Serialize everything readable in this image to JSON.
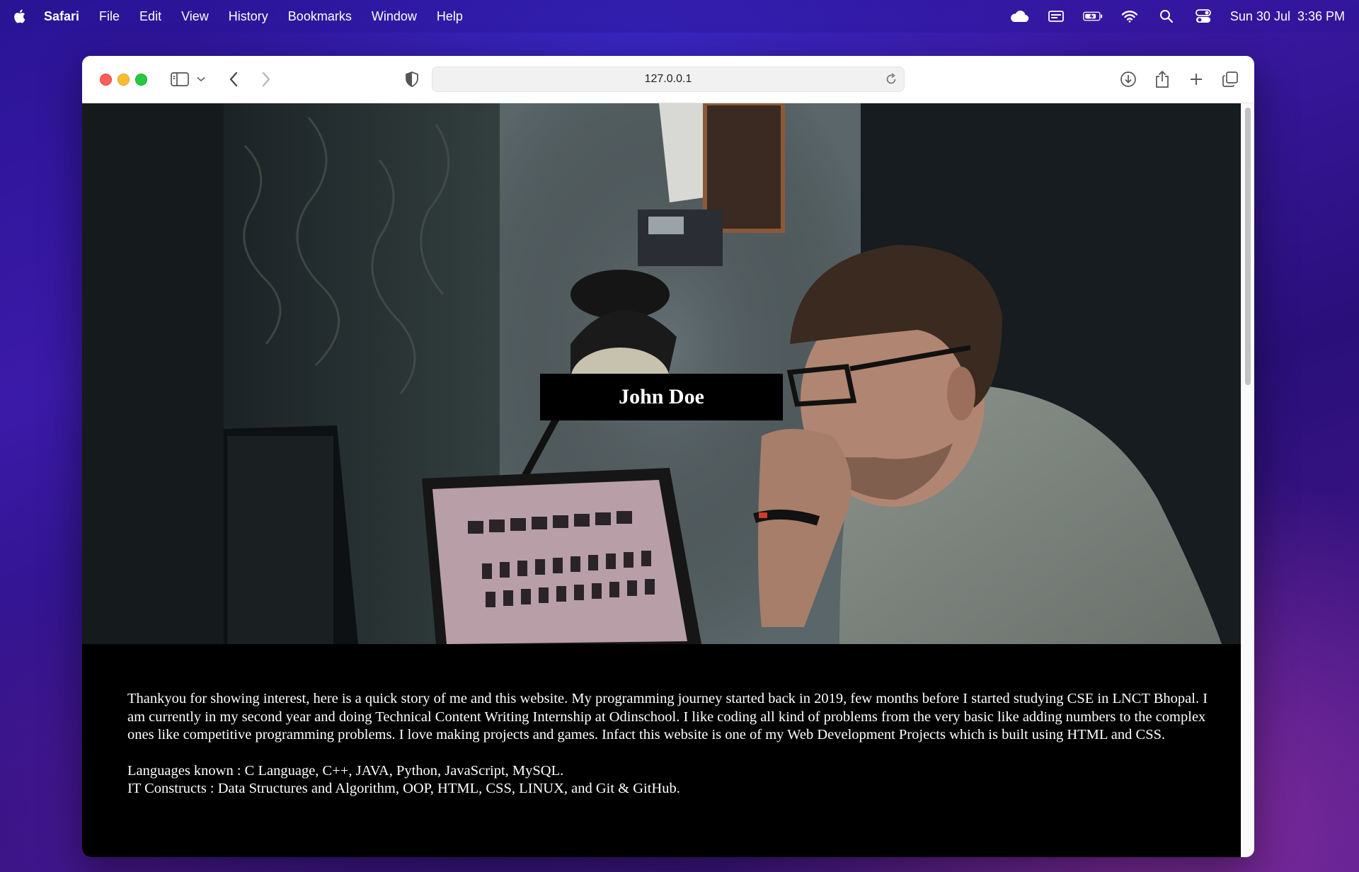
{
  "menubar": {
    "app": "Safari",
    "items": [
      "File",
      "Edit",
      "View",
      "History",
      "Bookmarks",
      "Window",
      "Help"
    ],
    "date": "Sun 30 Jul",
    "time": "3:36 PM",
    "status_icons": [
      "cloud-icon",
      "screen-icon",
      "battery-icon",
      "wifi-icon",
      "search-icon",
      "control-center-icon"
    ]
  },
  "browser": {
    "url": "127.0.0.1",
    "toolbar_icons": [
      "sidebar-icon",
      "chevron-down-icon",
      "back-icon",
      "forward-icon",
      "shield-icon",
      "reload-icon",
      "download-icon",
      "share-icon",
      "new-tab-icon",
      "tabs-overview-icon"
    ]
  },
  "page": {
    "name": "John Doe",
    "story": "Thankyou for showing interest, here is a quick story of me and this website. My programming journey started back in 2019, few months before I started studying CSE in LNCT Bhopal. I am currently in my second year and doing Technical Content Writing Internship at Odinschool. I like coding all kind of problems from the very basic like adding numbers to the complex ones like competitive programming problems. I love making projects and games. Infact this website is one of my Web Development Projects which is built using HTML and CSS.",
    "languages": "Languages known : C Language, C++, JAVA, Python, JavaScript, MySQL.",
    "constructs": "IT Constructs : Data Structures and Algorithm, OOP, HTML, CSS, LINUX, and Git & GitHub."
  },
  "colors": {
    "page_bg": "#000000",
    "text": "#ffffff",
    "close": "#ff5f57",
    "minimize": "#febc2e",
    "maximize": "#28c840"
  }
}
